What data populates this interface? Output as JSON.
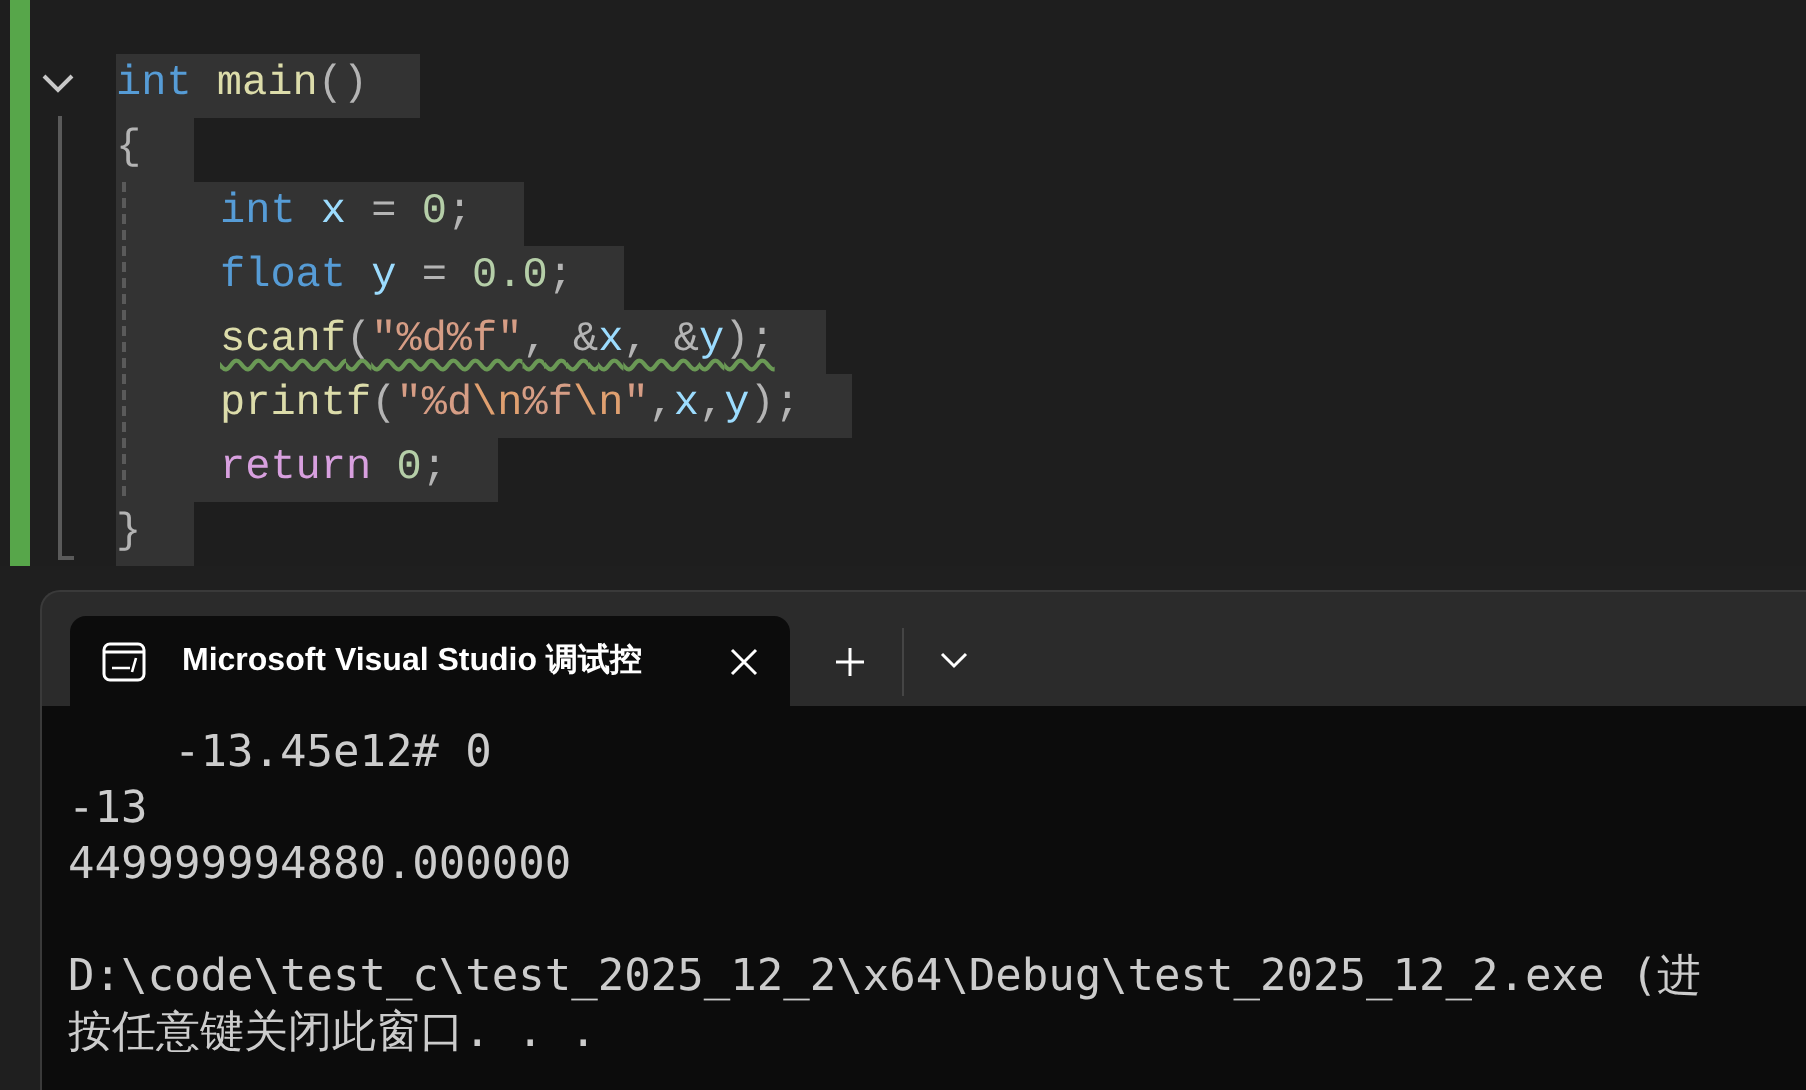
{
  "editor": {
    "expanded": true,
    "header": [
      {
        "kind": "keyword",
        "text": "int"
      },
      {
        "kind": "function",
        "text": " main"
      },
      {
        "kind": "punct",
        "text": "()"
      }
    ],
    "open": "{",
    "body": [
      {
        "warning": false,
        "tokens": [
          {
            "kind": "keyword",
            "text": "int"
          },
          {
            "kind": "variable",
            "text": " x"
          },
          {
            "kind": "punct",
            "text": " = "
          },
          {
            "kind": "number",
            "text": "0"
          },
          {
            "kind": "punct",
            "text": ";"
          }
        ]
      },
      {
        "warning": false,
        "tokens": [
          {
            "kind": "keyword",
            "text": "float"
          },
          {
            "kind": "variable",
            "text": " y"
          },
          {
            "kind": "punct",
            "text": " = "
          },
          {
            "kind": "number",
            "text": "0.0"
          },
          {
            "kind": "punct",
            "text": ";"
          }
        ]
      },
      {
        "warning": true,
        "tokens": [
          {
            "kind": "function",
            "text": "scanf"
          },
          {
            "kind": "punct",
            "text": "("
          },
          {
            "kind": "string",
            "text": "\"%d%f\""
          },
          {
            "kind": "punct",
            "text": ", &"
          },
          {
            "kind": "variable",
            "text": "x"
          },
          {
            "kind": "punct",
            "text": ", &"
          },
          {
            "kind": "variable",
            "text": "y"
          },
          {
            "kind": "punct",
            "text": ");"
          }
        ]
      },
      {
        "warning": false,
        "tokens": [
          {
            "kind": "function",
            "text": "printf"
          },
          {
            "kind": "punct",
            "text": "("
          },
          {
            "kind": "string",
            "text": "\"%d"
          },
          {
            "kind": "escape",
            "text": "\\n"
          },
          {
            "kind": "string",
            "text": "%f"
          },
          {
            "kind": "escape",
            "text": "\\n"
          },
          {
            "kind": "string",
            "text": "\""
          },
          {
            "kind": "punct",
            "text": ","
          },
          {
            "kind": "variable",
            "text": "x"
          },
          {
            "kind": "punct",
            "text": ","
          },
          {
            "kind": "variable",
            "text": "y"
          },
          {
            "kind": "punct",
            "text": ");"
          }
        ]
      },
      {
        "warning": false,
        "tokens": [
          {
            "kind": "control",
            "text": "return"
          },
          {
            "kind": "number",
            "text": " 0"
          },
          {
            "kind": "punct",
            "text": ";"
          }
        ]
      }
    ],
    "close": "}"
  },
  "terminal": {
    "tab": {
      "title": "Microsoft Visual Studio 调试控",
      "selected": true
    },
    "output": [
      "    -13.45e12# 0",
      "-13",
      "449999994880.000000"
    ],
    "prompt": [
      "D:\\code\\test_c\\test_2025_12_2\\x64\\Debug\\test_2025_12_2.exe (进",
      "按任意键关闭此窗口. . ."
    ]
  }
}
